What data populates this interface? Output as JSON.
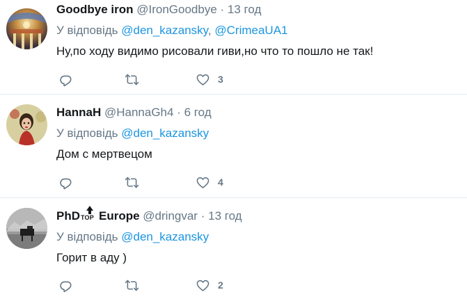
{
  "tweets": [
    {
      "name": "Goodbye iron",
      "handle": "@IronGoodbye",
      "separator": "·",
      "time": "13 год",
      "reply_prefix": "У відповідь",
      "mentions": [
        "@den_kazansky",
        "@CrimeaUA1"
      ],
      "mention_separator": ",",
      "text": "Ну,по ходу видимо рисовали  гиви,но что то пошло не так!",
      "like_count": "3"
    },
    {
      "name": "HannaH",
      "handle": "@HannaGh4",
      "separator": "·",
      "time": "6 год",
      "reply_prefix": "У відповідь",
      "mentions": [
        "@den_kazansky"
      ],
      "text": "Дом с мертвецом",
      "like_count": "4"
    },
    {
      "name_part1": "PhD",
      "name_badge": "TOP",
      "name_part2": "Europe",
      "handle": "@dringvar",
      "separator": "·",
      "time": "13 год",
      "reply_prefix": "У відповідь",
      "mentions": [
        "@den_kazansky"
      ],
      "text": "Горит в аду )",
      "like_count": "2"
    }
  ],
  "icons": {
    "reply": "reply-icon",
    "retweet": "retweet-icon",
    "like": "heart-icon"
  },
  "colors": {
    "link": "#1b95e0",
    "secondary_text": "#657786",
    "divider": "#e6ecf0"
  }
}
